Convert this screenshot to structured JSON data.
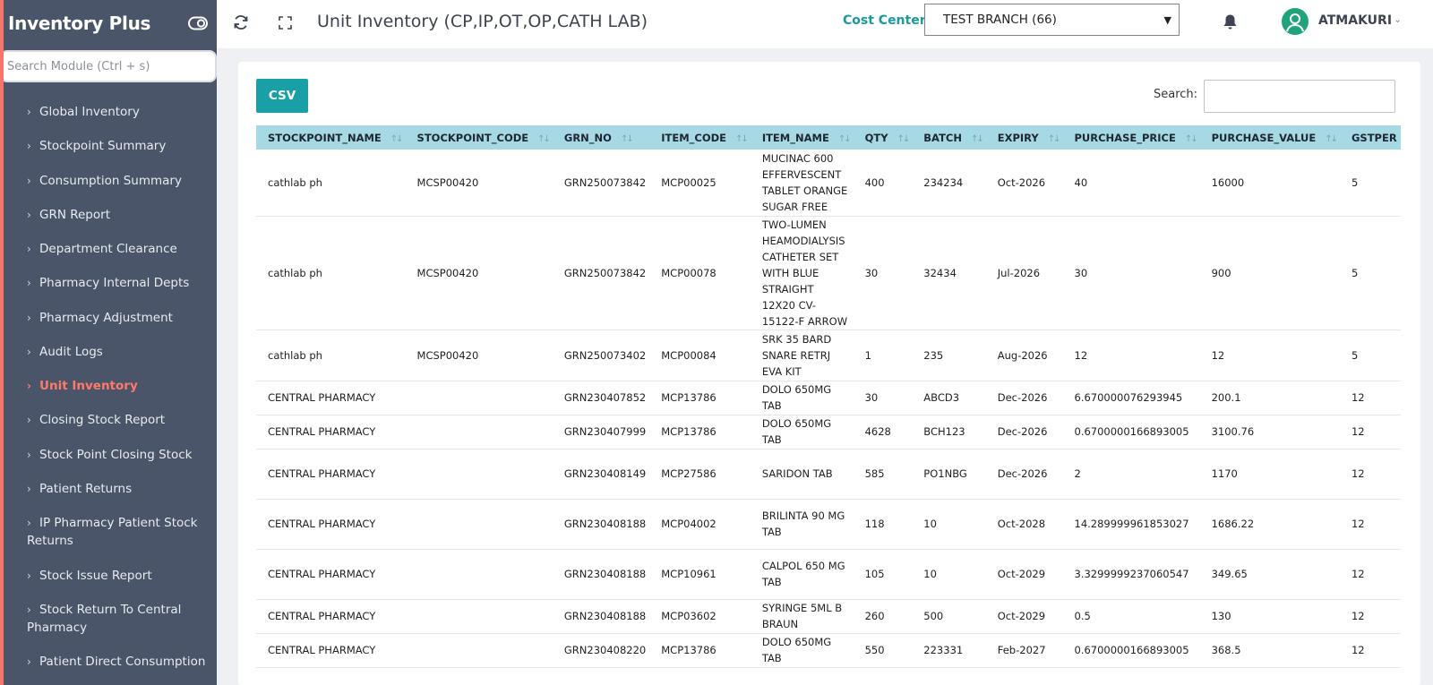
{
  "app": {
    "title": "Inventory Plus"
  },
  "sidebar": {
    "search_placeholder": "Search Module (Ctrl + s)",
    "items": [
      {
        "label": "Global Inventory",
        "active": false
      },
      {
        "label": "Stockpoint Summary",
        "active": false
      },
      {
        "label": "Consumption Summary",
        "active": false
      },
      {
        "label": "GRN Report",
        "active": false
      },
      {
        "label": "Department Clearance",
        "active": false
      },
      {
        "label": "Pharmacy Internal Depts",
        "active": false
      },
      {
        "label": "Pharmacy Adjustment",
        "active": false
      },
      {
        "label": "Audit Logs",
        "active": false
      },
      {
        "label": "Unit Inventory",
        "active": true
      },
      {
        "label": "Closing Stock Report",
        "active": false
      },
      {
        "label": "Stock Point Closing Stock",
        "active": false
      },
      {
        "label": "Patient Returns",
        "active": false
      },
      {
        "label": "IP Pharmacy Patient Stock Returns",
        "active": false
      },
      {
        "label": "Stock Issue Report",
        "active": false
      },
      {
        "label": "Stock Return To Central Pharmacy",
        "active": false
      },
      {
        "label": "Patient Direct Consumption",
        "active": false
      }
    ]
  },
  "header": {
    "page_title": "Unit Inventory (CP,IP,OT,OP,CATH LAB)",
    "cost_center_label": "Cost Center :",
    "cost_center_value": "TEST BRANCH (66)",
    "user_name": "ATMAKURI"
  },
  "toolbar": {
    "csv_label": "CSV",
    "search_label": "Search:",
    "search_value": ""
  },
  "table": {
    "columns": [
      "STOCKPOINT_NAME",
      "STOCKPOINT_CODE",
      "GRN_NO",
      "ITEM_CODE",
      "ITEM_NAME",
      "QTY",
      "BATCH",
      "EXPIRY",
      "PURCHASE_PRICE",
      "PURCHASE_VALUE",
      "GSTPER"
    ],
    "rows": [
      [
        "cathlab ph",
        "MCSP00420",
        "GRN250073842",
        "MCP00025",
        "MUCINAC 600 EFFERVESCENT TABLET ORANGE SUGAR FREE",
        "400",
        "234234",
        "Oct-2026",
        "40",
        "16000",
        "5"
      ],
      [
        "cathlab ph",
        "MCSP00420",
        "GRN250073842",
        "MCP00078",
        "TWO-LUMEN HEAMODIALYSIS CATHETER SET WITH BLUE STRAIGHT 12X20 CV-15122-F ARROW",
        "30",
        "32434",
        "Jul-2026",
        "30",
        "900",
        "5"
      ],
      [
        "cathlab ph",
        "MCSP00420",
        "GRN250073402",
        "MCP00084",
        "SRK 35 BARD SNARE RETRJ EVA KIT",
        "1",
        "235",
        "Aug-2026",
        "12",
        "12",
        "5"
      ],
      [
        "CENTRAL PHARMACY",
        "",
        "GRN230407852",
        "MCP13786",
        "DOLO 650MG TAB",
        "30",
        "ABCD3",
        "Dec-2026",
        "6.670000076293945",
        "200.1",
        "12"
      ],
      [
        "CENTRAL PHARMACY",
        "",
        "GRN230407999",
        "MCP13786",
        "DOLO 650MG TAB",
        "4628",
        "BCH123",
        "Dec-2026",
        "0.6700000166893005",
        "3100.76",
        "12"
      ],
      [
        "CENTRAL PHARMACY",
        "",
        "GRN230408149",
        "MCP27586",
        "SARIDON TAB",
        "585",
        "PO1NBG",
        "Dec-2026",
        "2",
        "1170",
        "12"
      ],
      [
        "CENTRAL PHARMACY",
        "",
        "GRN230408188",
        "MCP04002",
        "BRILINTA 90 MG TAB",
        "118",
        "10",
        "Oct-2028",
        "14.289999961853027",
        "1686.22",
        "12"
      ],
      [
        "CENTRAL PHARMACY",
        "",
        "GRN230408188",
        "MCP10961",
        "CALPOL 650 MG TAB",
        "105",
        "10",
        "Oct-2029",
        "3.3299999237060547",
        "349.65",
        "12"
      ],
      [
        "CENTRAL PHARMACY",
        "",
        "GRN230408188",
        "MCP03602",
        "SYRINGE 5ML B BRAUN",
        "260",
        "500",
        "Oct-2029",
        "0.5",
        "130",
        "12"
      ],
      [
        "CENTRAL PHARMACY",
        "",
        "GRN230408220",
        "MCP13786",
        "DOLO 650MG TAB",
        "550",
        "223331",
        "Feb-2027",
        "0.6700000166893005",
        "368.5",
        "12"
      ]
    ]
  },
  "colors": {
    "sidebar_bg": "#4a556a",
    "accent": "#18a0a6",
    "active_nav": "#ff7a6b",
    "table_header": "#a7d9e5"
  }
}
